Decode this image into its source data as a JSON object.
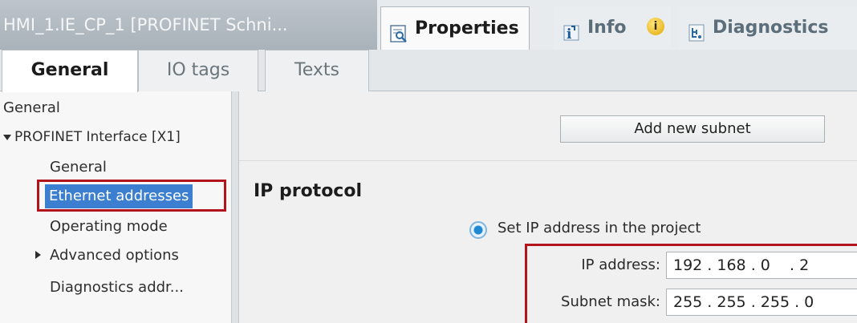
{
  "window": {
    "title": "HMI_1.IE_CP_1 [PROFINET Schni..."
  },
  "top_tabs": [
    {
      "label": "Properties",
      "icon": "properties-icon",
      "active": true
    },
    {
      "label": "Info",
      "icon": "info-icon",
      "active": false
    },
    {
      "label": "Diagnostics",
      "icon": "diagnostics-icon",
      "active": false
    }
  ],
  "info_badge": "i",
  "sub_tabs": [
    {
      "label": "General",
      "active": true
    },
    {
      "label": "IO tags",
      "active": false
    },
    {
      "label": "Texts",
      "active": false
    }
  ],
  "nav": {
    "general": "General",
    "profinet": "PROFINET Interface [X1]",
    "sub_general": "General",
    "ethernet": "Ethernet addresses",
    "operating": "Operating mode",
    "advanced": "Advanced options",
    "diag_addr": "Diagnostics addr..."
  },
  "main": {
    "add_subnet": "Add new subnet",
    "ip_protocol": "IP protocol",
    "radio_label": "Set IP address in the project",
    "ip_label": "IP address:",
    "ip_value": "192 . 168 . 0    . 2",
    "mask_label": "Subnet mask:",
    "mask_value": "255 . 255 . 255 . 0"
  },
  "colors": {
    "selection": "#3c7fd0",
    "highlight_box": "#b1141c",
    "radio": "#1e88d0"
  }
}
